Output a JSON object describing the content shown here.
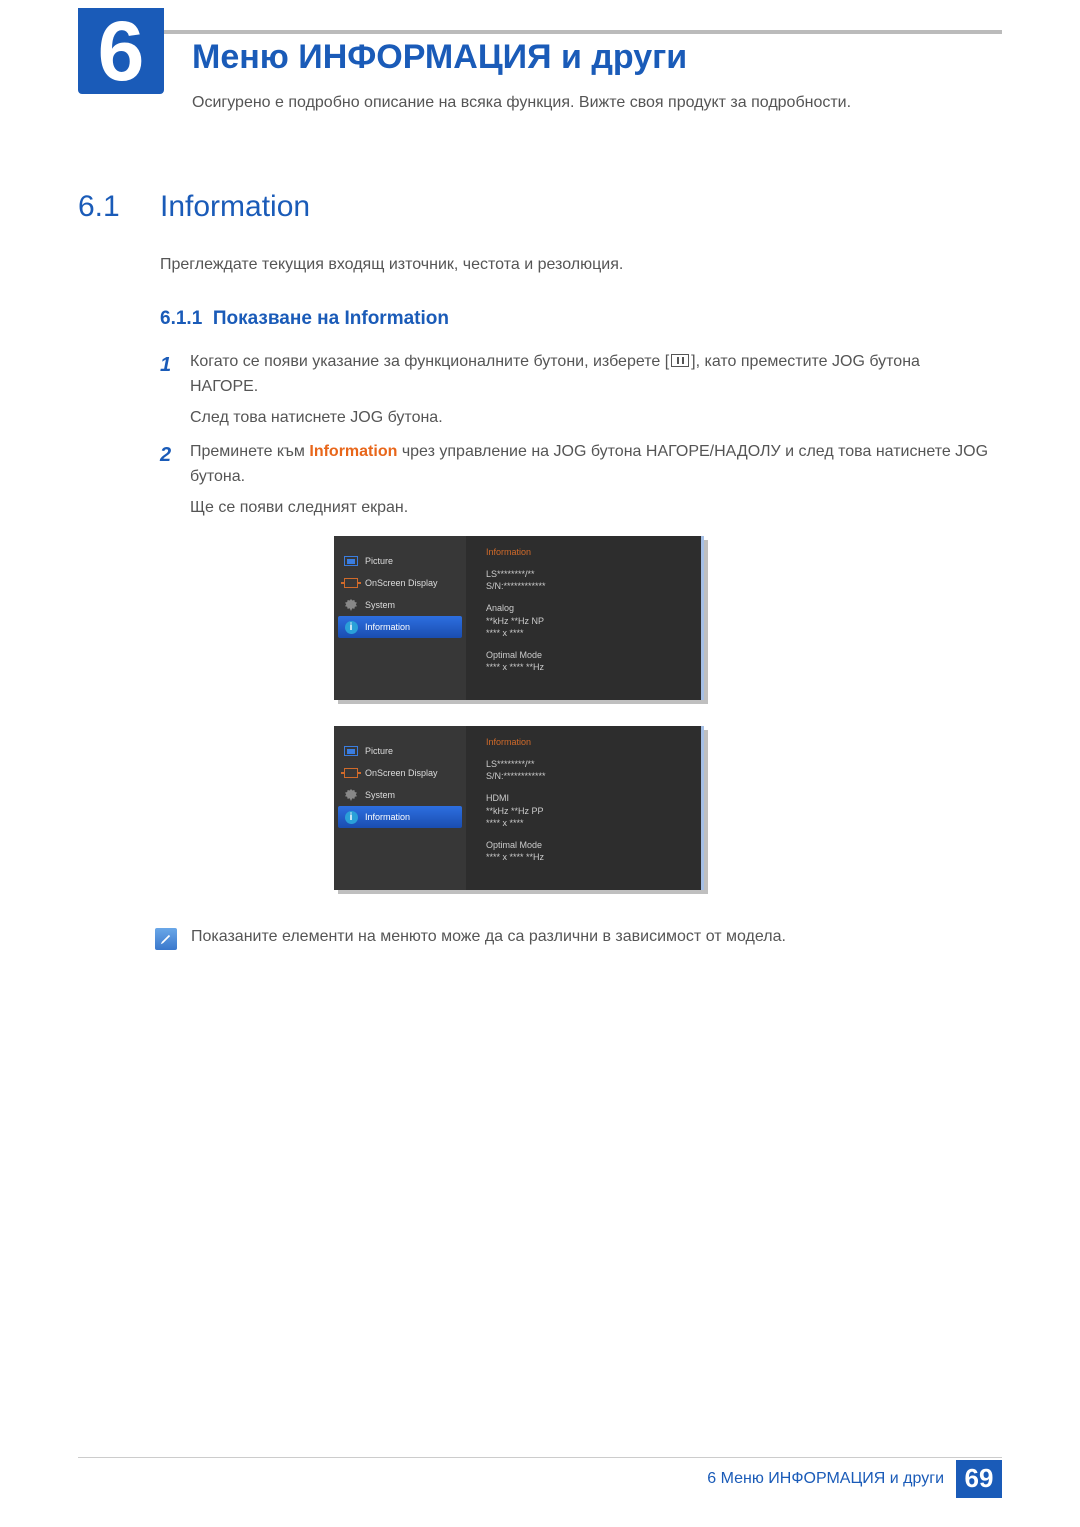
{
  "chapter": {
    "num": "6",
    "title": "Меню ИНФОРМАЦИЯ и други",
    "desc": "Осигурено е подробно описание на всяка функция. Вижте своя продукт за подробности."
  },
  "section": {
    "num": "6.1",
    "title": "Information",
    "desc": "Преглеждате текущия входящ източник, честота и резолюция."
  },
  "subsection": {
    "num": "6.1.1",
    "title": "Показване на Information"
  },
  "steps": {
    "s1_a": "Когато се появи указание за функционалните бутони, изберете [",
    "s1_b": "], като преместите JOG бутона НАГОРЕ.",
    "s1_c": "След това натиснете JOG бутона.",
    "s2_a": "Преминете към ",
    "s2_kw": "Information",
    "s2_b": " чрез управление на JOG бутона НАГОРЕ/НАДОЛУ и след това натиснете JOG бутона.",
    "s2_c": "Ще се появи следният екран."
  },
  "osd": {
    "menu": {
      "picture": "Picture",
      "osd": "OnScreen Display",
      "system": "System",
      "info": "Information"
    },
    "panel1": {
      "title": "Information",
      "l1": "LS********/**",
      "l2": "S/N:************",
      "l3": "Analog",
      "l4": "**kHz **Hz NP",
      "l5": "**** x ****",
      "l6": "Optimal Mode",
      "l7": "**** x **** **Hz"
    },
    "panel2": {
      "title": "Information",
      "l1": "LS********/**",
      "l2": "S/N:************",
      "l3": "HDMI",
      "l4": "**kHz **Hz PP",
      "l5": "**** x ****",
      "l6": "Optimal Mode",
      "l7": "**** x **** **Hz"
    }
  },
  "note": "Показаните елементи на менюто може да са различни в зависимост от модела.",
  "footer": {
    "text": "6 Меню ИНФОРМАЦИЯ и други",
    "page": "69"
  }
}
